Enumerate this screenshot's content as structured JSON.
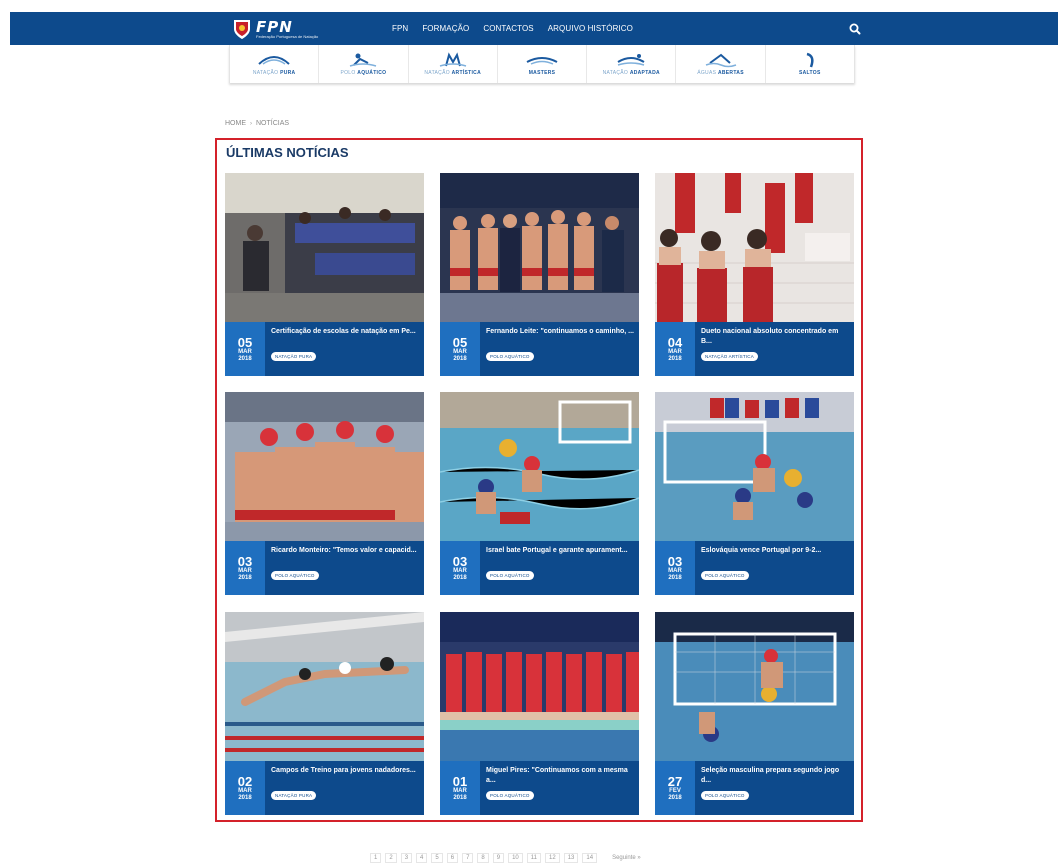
{
  "header": {
    "logo_text": "FPN",
    "logo_sub": "Federação Portuguesa de Natação",
    "nav": [
      "FPN",
      "FORMAÇÃO",
      "CONTACTOS",
      "ARQUIVO HISTÓRICO"
    ]
  },
  "disciplines": [
    {
      "light": "NATAÇÃO",
      "bold": "PURA"
    },
    {
      "light": "POLO",
      "bold": "AQUÁTICO"
    },
    {
      "light": "NATAÇÃO",
      "bold": "ARTÍSTICA"
    },
    {
      "light": "",
      "bold": "MASTERS"
    },
    {
      "light": "NATAÇÃO",
      "bold": "ADAPTADA"
    },
    {
      "light": "ÁGUAS",
      "bold": "ABERTAS"
    },
    {
      "light": "",
      "bold": "SALTOS"
    }
  ],
  "breadcrumb": {
    "home": "HOME",
    "sep": "›",
    "current": "NOTÍCIAS"
  },
  "section_title": "ÚLTIMAS NOTÍCIAS",
  "news": [
    {
      "day": "05",
      "month": "MAR",
      "year": "2018",
      "title": "Certificação de escolas de natação em Pe...",
      "tag": "NATAÇÃO PURA"
    },
    {
      "day": "05",
      "month": "MAR",
      "year": "2018",
      "title": "Fernando Leite: \"continuamos o caminho, ...",
      "tag": "POLO AQUÁTICO"
    },
    {
      "day": "04",
      "month": "MAR",
      "year": "2018",
      "title": "Dueto nacional absoluto concentrado em B...",
      "tag": "NATAÇÃO ARTÍSTICA"
    },
    {
      "day": "03",
      "month": "MAR",
      "year": "2018",
      "title": "Ricardo Monteiro: \"Temos valor e capacid...",
      "tag": "POLO AQUÁTICO"
    },
    {
      "day": "03",
      "month": "MAR",
      "year": "2018",
      "title": "Israel bate Portugal e garante apurament...",
      "tag": "POLO AQUÁTICO"
    },
    {
      "day": "03",
      "month": "MAR",
      "year": "2018",
      "title": "Eslováquia vence Portugal por 9-2...",
      "tag": "POLO AQUÁTICO"
    },
    {
      "day": "02",
      "month": "MAR",
      "year": "2018",
      "title": "Campos de Treino para jovens nadadores...",
      "tag": "NATAÇÃO PURA"
    },
    {
      "day": "01",
      "month": "MAR",
      "year": "2018",
      "title": "Miguel Pires: \"Continuamos com a mesma a...",
      "tag": "POLO AQUÁTICO"
    },
    {
      "day": "27",
      "month": "FEV",
      "year": "2018",
      "title": "Seleção masculina prepara segundo jogo d...",
      "tag": "POLO AQUÁTICO"
    }
  ],
  "pagination": {
    "pages": [
      "1",
      "2",
      "3",
      "4",
      "5",
      "6",
      "7",
      "8",
      "9",
      "10",
      "11",
      "12",
      "13",
      "14"
    ],
    "next": "Seguinte »"
  },
  "colors": {
    "primary": "#0d4a8c",
    "date_block": "#1f6fbf",
    "highlight": "#d4212a"
  }
}
